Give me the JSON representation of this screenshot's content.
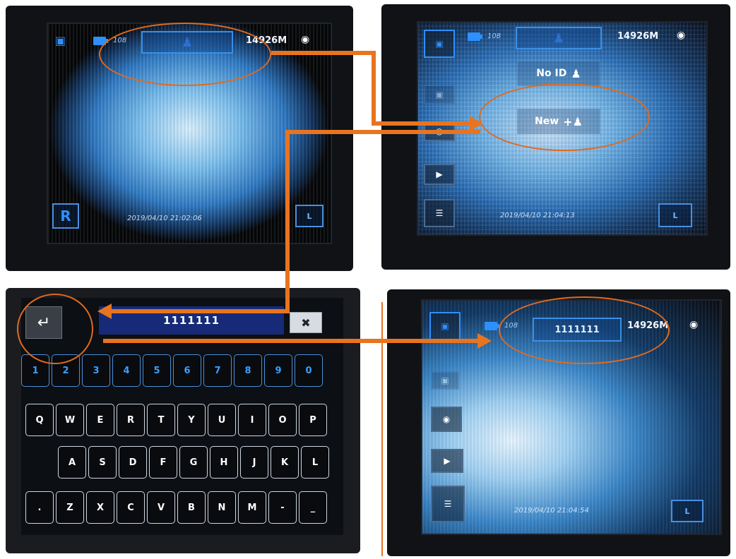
{
  "colors": {
    "arrow": "#e87420",
    "accent": "#2e8fff",
    "panel": "#101216",
    "entry_bg": "#162a78"
  },
  "panel_tl": {
    "shot_count": "108",
    "memory": "14926M",
    "timestamp": "2019/04/10 21:02:06",
    "left_badge": "R",
    "right_badge": "L",
    "id_icon": "person-icon"
  },
  "panel_tr": {
    "shot_count": "108",
    "memory": "14926M",
    "timestamp": "2019/04/10 21:04:13",
    "right_badge": "L",
    "menu": [
      {
        "label": "No ID",
        "icon": "person-icon"
      },
      {
        "label": "New",
        "icon": "add-person-icon"
      }
    ]
  },
  "panel_bl": {
    "entry_text": "1111111",
    "rows": [
      [
        "1",
        "2",
        "3",
        "4",
        "5",
        "6",
        "7",
        "8",
        "9",
        "0"
      ],
      [
        "Q",
        "W",
        "E",
        "R",
        "T",
        "Y",
        "U",
        "I",
        "O",
        "P"
      ],
      [
        "A",
        "S",
        "D",
        "F",
        "G",
        "H",
        "J",
        "K",
        "L"
      ],
      [
        ".",
        "Z",
        "X",
        "C",
        "V",
        "B",
        "N",
        "M",
        "-",
        "_"
      ]
    ],
    "enter_icon": "enter-icon",
    "backspace_icon": "backspace-icon"
  },
  "panel_br": {
    "shot_count": "108",
    "id_value": "1111111",
    "memory": "14926M",
    "timestamp": "2019/04/10 21:04:54",
    "right_badge": "L"
  }
}
